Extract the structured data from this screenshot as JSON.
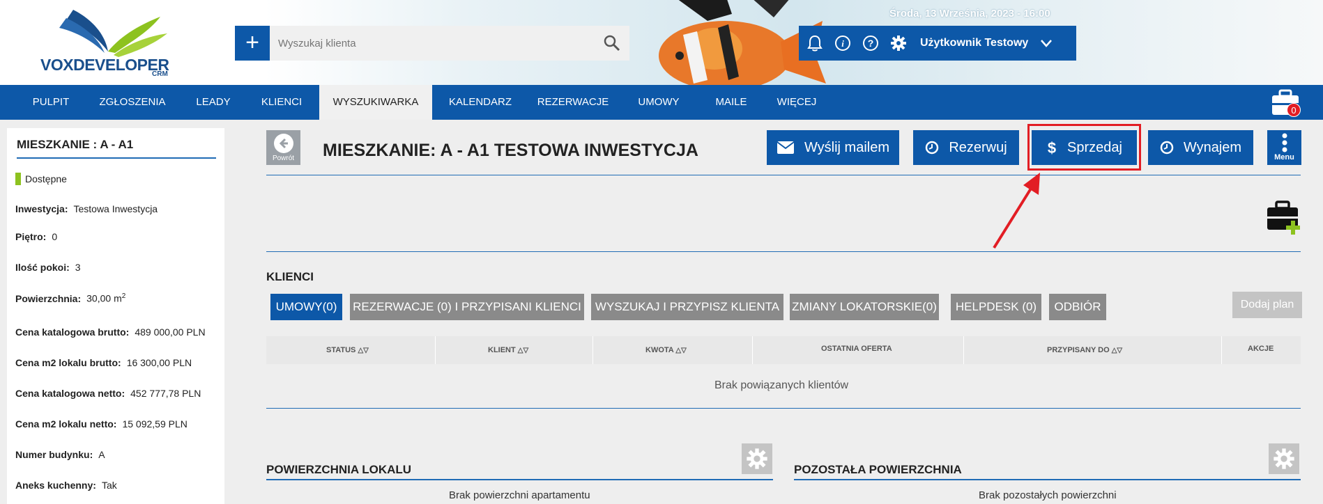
{
  "header": {
    "logo_brand": "VOXDEVELOPER",
    "logo_brand_part1": "VOX",
    "logo_brand_part2": "DEVELOPER",
    "logo_sub": "CRM",
    "search_placeholder": "Wyszukaj klienta",
    "datetime": "Środa, 13 Września, 2023 - 16:00",
    "user_name": "Użytkownik Testowy"
  },
  "nav": {
    "items": [
      "PULPIT",
      "ZGŁOSZENIA",
      "LEADY",
      "KLIENCI",
      "WYSZUKIWARKA",
      "KALENDARZ",
      "REZERWACJE",
      "UMOWY",
      "MAILE",
      "WIĘCEJ"
    ],
    "active": "WYSZUKIWARKA",
    "cart_count": "0"
  },
  "sidebar": {
    "title": "MIESZKANIE : A - A1",
    "status": "Dostępne",
    "status_color": "#8dc21f",
    "rows": [
      {
        "label": "Inwestycja:",
        "value": "Testowa Inwestycja"
      },
      {
        "label": "Piętro:",
        "value": "0"
      },
      {
        "label": "Ilość pokoi:",
        "value": "3"
      },
      {
        "label": "Powierzchnia:",
        "value": "30,00 m",
        "sup": "2"
      },
      {
        "label": "Cena katalogowa brutto:",
        "value": "489 000,00 PLN"
      },
      {
        "label": "Cena m2 lokalu brutto:",
        "value": "16 300,00 PLN"
      },
      {
        "label": "Cena katalogowa netto:",
        "value": "452 777,78 PLN"
      },
      {
        "label": "Cena m2 lokalu netto:",
        "value": "15 092,59 PLN"
      },
      {
        "label": "Numer budynku:",
        "value": "A"
      },
      {
        "label": "Aneks kuchenny:",
        "value": "Tak"
      }
    ]
  },
  "main": {
    "back_label": "Powrót",
    "title": "MIESZKANIE: A - A1 TESTOWA INWESTYCJA",
    "actions": {
      "mail": "Wyślij mailem",
      "reserve": "Rezerwuj",
      "sell": "Sprzedaj",
      "rent": "Wynajem",
      "menu": "Menu"
    },
    "clients_title": "KLIENCI",
    "tabs": [
      "UMOWY(0)",
      "REZERWACJE (0) I PRZYPISANI KLIENCI",
      "WYSZUKAJ I PRZYPISZ KLIENTA",
      "ZMIANY LOKATORSKIE(0)",
      "HELPDESK (0)",
      "ODBIÓR"
    ],
    "add_plan": "Dodaj plan",
    "table_headers": [
      "STATUS",
      "KLIENT",
      "KWOTA",
      "OSTATNIA OFERTA",
      "PRZYPISANY DO",
      "AKCJE"
    ],
    "empty_clients": "Brak powiązanych klientów",
    "surface_title": "POWIERZCHNIA LOKALU",
    "surface_empty": "Brak powierzchni apartamentu",
    "other_title": "POZOSTAŁA POWIERZCHNIA",
    "other_empty": "Brak pozostałych powierzchni"
  },
  "colors": {
    "primary": "#0d58a8",
    "highlight": "#e21d24",
    "tab_gray": "#8a8a8a",
    "available": "#8dc21f"
  }
}
